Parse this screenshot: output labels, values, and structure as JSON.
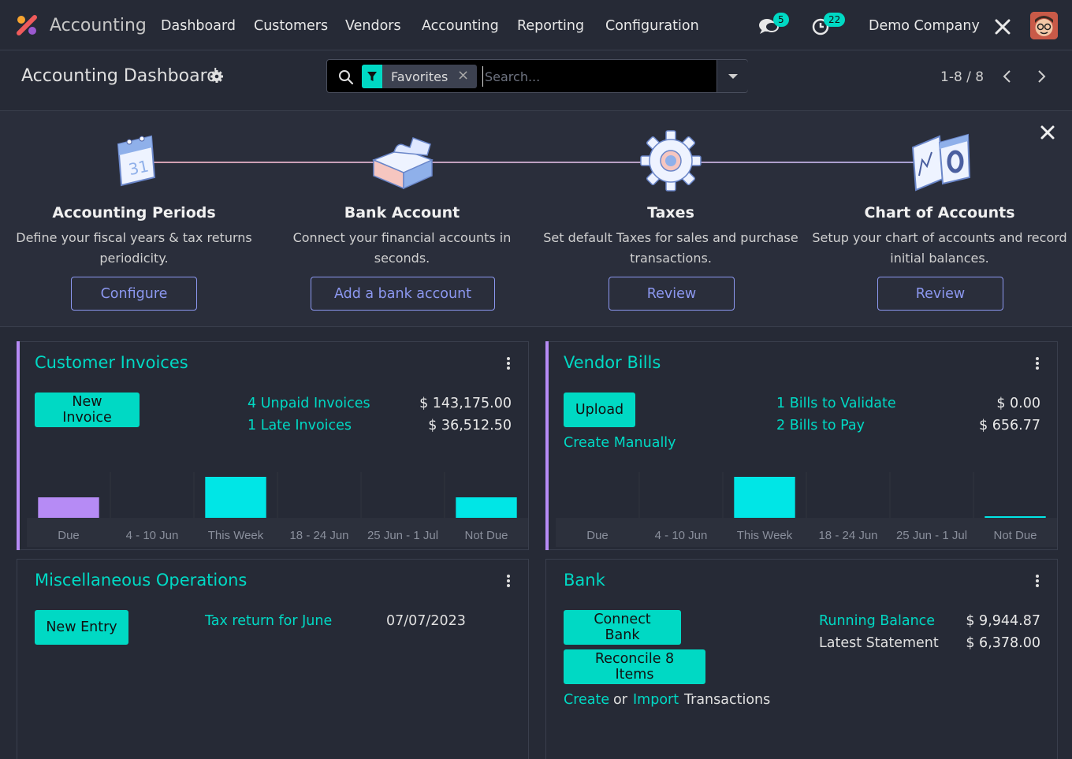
{
  "colors": {
    "accent": "#00d9c4",
    "purple_bar": "#b68bf5",
    "cyan_bar": "#00e6e6",
    "outline": "#8c98f0"
  },
  "topnav": {
    "app_name": "Accounting",
    "menu": [
      "Dashboard",
      "Customers",
      "Vendors",
      "Accounting",
      "Reporting",
      "Configuration"
    ],
    "messages_count": "5",
    "activities_count": "22",
    "company": "Demo Company"
  },
  "control": {
    "title": "Accounting Dashboard",
    "facet_label": "Favorites",
    "search_placeholder": "Search...",
    "pager": "1-8 / 8"
  },
  "onboarding": [
    {
      "title": "Accounting Periods",
      "desc1": "Define your fiscal years & tax returns",
      "desc2": "periodicity.",
      "button": "Configure"
    },
    {
      "title": "Bank Account",
      "desc1": "Connect your financial accounts in",
      "desc2": "seconds.",
      "button": "Add a bank account"
    },
    {
      "title": "Taxes",
      "desc1": "Set default Taxes for sales and purchase",
      "desc2": "transactions.",
      "button": "Review"
    },
    {
      "title": "Chart of Accounts",
      "desc1": "Setup your chart of accounts and record",
      "desc2": "initial balances.",
      "button": "Review"
    }
  ],
  "customer_invoices": {
    "title": "Customer Invoices",
    "new_button": "New Invoice",
    "unpaid_link": "4 Unpaid Invoices",
    "unpaid_amount": "$ 143,175.00",
    "late_link": "1 Late Invoices",
    "late_amount": "$ 36,512.50"
  },
  "vendor_bills": {
    "title": "Vendor Bills",
    "upload_button": "Upload",
    "create_manually": "Create Manually",
    "validate_link": "1 Bills to Validate",
    "validate_amount": "$ 0.00",
    "pay_link": "2 Bills to Pay",
    "pay_amount": "$ 656.77"
  },
  "misc_operations": {
    "title": "Miscellaneous Operations",
    "new_button": "New Entry",
    "tax_link": "Tax return for June",
    "tax_date": "07/07/2023"
  },
  "bank": {
    "title": "Bank",
    "connect_button": "Connect Bank",
    "reconcile_button": "Reconcile 8 Items",
    "create_link": "Create",
    "or_text": "or",
    "import_link": "Import",
    "transactions_text": "Transactions",
    "running_label": "Running Balance",
    "running_amount": "$ 9,944.87",
    "statement_label": "Latest Statement",
    "statement_amount": "$ 6,378.00"
  },
  "chart_data": [
    {
      "type": "bar",
      "categories": [
        "Due",
        "4 - 10 Jun",
        "This Week",
        "18 - 24 Jun",
        "25 Jun - 1 Jul",
        "Not Due"
      ],
      "values": [
        0.5,
        0,
        1,
        0,
        0,
        0.5
      ],
      "colors": [
        "#b68bf5",
        "#00e6e6",
        "#00e6e6",
        "#00e6e6",
        "#00e6e6",
        "#00e6e6"
      ]
    },
    {
      "type": "bar",
      "categories": [
        "Due",
        "4 - 10 Jun",
        "This Week",
        "18 - 24 Jun",
        "25 Jun - 1 Jul",
        "Not Due"
      ],
      "values": [
        0,
        0,
        1,
        0,
        0,
        0.02
      ],
      "colors": [
        "#00e6e6",
        "#00e6e6",
        "#00e6e6",
        "#00e6e6",
        "#00e6e6",
        "#00e6e6"
      ]
    }
  ]
}
